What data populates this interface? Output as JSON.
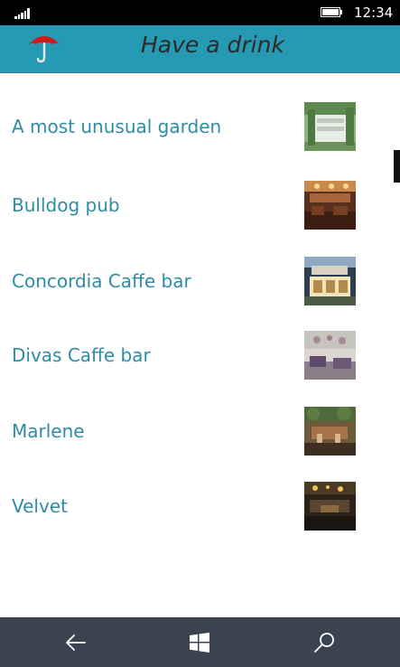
{
  "status_bar": {
    "time": "12:34",
    "icons": [
      "signal-icon",
      "battery-icon"
    ]
  },
  "header": {
    "title": "Have a drink",
    "logo_icon": "umbrella-icon",
    "background_color": "#2699b3",
    "logo_color": "#d11a1a"
  },
  "list": {
    "items": [
      {
        "label": "A most unusual garden",
        "thumbnail": "garden-photo"
      },
      {
        "label": "Bulldog pub",
        "thumbnail": "pub-interior-photo"
      },
      {
        "label": "Concordia Caffe bar",
        "thumbnail": "cafe-front-photo"
      },
      {
        "label": "Divas Caffe bar",
        "thumbnail": "cafe-interior-photo"
      },
      {
        "label": "Marlene",
        "thumbnail": "bar-terrace-photo"
      },
      {
        "label": "Velvet",
        "thumbnail": "bar-night-photo"
      }
    ],
    "label_color": "#2f8ca6"
  },
  "bottom_nav": {
    "buttons": [
      "back-arrow-icon",
      "windows-start-icon",
      "search-icon"
    ],
    "background_color": "#3c4350"
  }
}
